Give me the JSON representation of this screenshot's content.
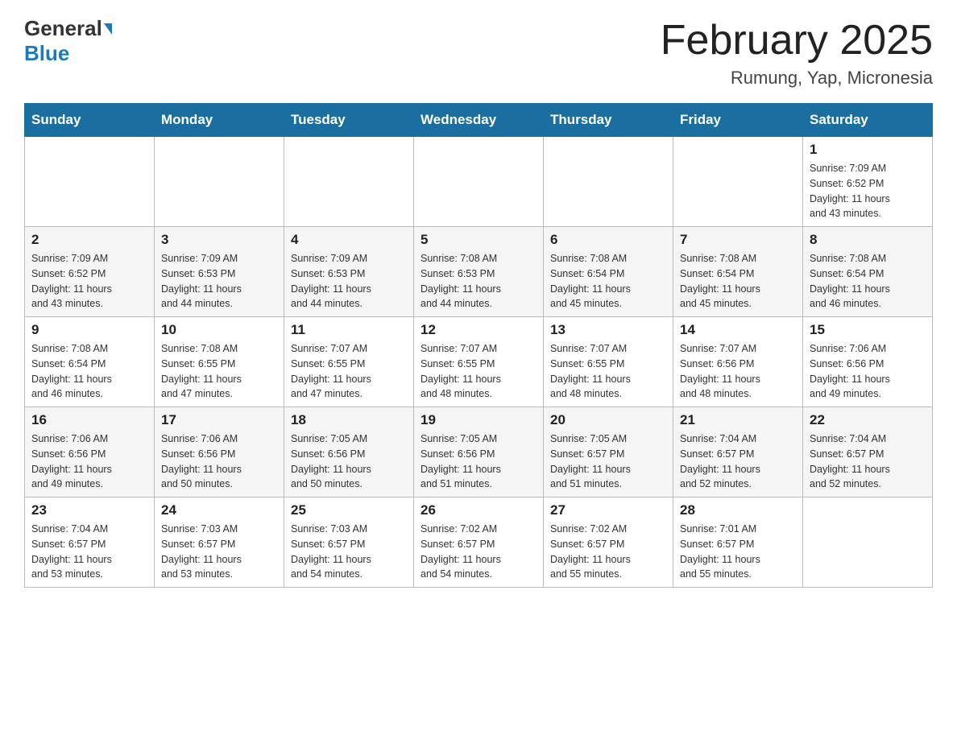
{
  "header": {
    "logo_general": "General",
    "logo_blue": "Blue",
    "month_title": "February 2025",
    "location": "Rumung, Yap, Micronesia"
  },
  "weekdays": [
    "Sunday",
    "Monday",
    "Tuesday",
    "Wednesday",
    "Thursday",
    "Friday",
    "Saturday"
  ],
  "weeks": [
    [
      {
        "day": "",
        "info": ""
      },
      {
        "day": "",
        "info": ""
      },
      {
        "day": "",
        "info": ""
      },
      {
        "day": "",
        "info": ""
      },
      {
        "day": "",
        "info": ""
      },
      {
        "day": "",
        "info": ""
      },
      {
        "day": "1",
        "info": "Sunrise: 7:09 AM\nSunset: 6:52 PM\nDaylight: 11 hours\nand 43 minutes."
      }
    ],
    [
      {
        "day": "2",
        "info": "Sunrise: 7:09 AM\nSunset: 6:52 PM\nDaylight: 11 hours\nand 43 minutes."
      },
      {
        "day": "3",
        "info": "Sunrise: 7:09 AM\nSunset: 6:53 PM\nDaylight: 11 hours\nand 44 minutes."
      },
      {
        "day": "4",
        "info": "Sunrise: 7:09 AM\nSunset: 6:53 PM\nDaylight: 11 hours\nand 44 minutes."
      },
      {
        "day": "5",
        "info": "Sunrise: 7:08 AM\nSunset: 6:53 PM\nDaylight: 11 hours\nand 44 minutes."
      },
      {
        "day": "6",
        "info": "Sunrise: 7:08 AM\nSunset: 6:54 PM\nDaylight: 11 hours\nand 45 minutes."
      },
      {
        "day": "7",
        "info": "Sunrise: 7:08 AM\nSunset: 6:54 PM\nDaylight: 11 hours\nand 45 minutes."
      },
      {
        "day": "8",
        "info": "Sunrise: 7:08 AM\nSunset: 6:54 PM\nDaylight: 11 hours\nand 46 minutes."
      }
    ],
    [
      {
        "day": "9",
        "info": "Sunrise: 7:08 AM\nSunset: 6:54 PM\nDaylight: 11 hours\nand 46 minutes."
      },
      {
        "day": "10",
        "info": "Sunrise: 7:08 AM\nSunset: 6:55 PM\nDaylight: 11 hours\nand 47 minutes."
      },
      {
        "day": "11",
        "info": "Sunrise: 7:07 AM\nSunset: 6:55 PM\nDaylight: 11 hours\nand 47 minutes."
      },
      {
        "day": "12",
        "info": "Sunrise: 7:07 AM\nSunset: 6:55 PM\nDaylight: 11 hours\nand 48 minutes."
      },
      {
        "day": "13",
        "info": "Sunrise: 7:07 AM\nSunset: 6:55 PM\nDaylight: 11 hours\nand 48 minutes."
      },
      {
        "day": "14",
        "info": "Sunrise: 7:07 AM\nSunset: 6:56 PM\nDaylight: 11 hours\nand 48 minutes."
      },
      {
        "day": "15",
        "info": "Sunrise: 7:06 AM\nSunset: 6:56 PM\nDaylight: 11 hours\nand 49 minutes."
      }
    ],
    [
      {
        "day": "16",
        "info": "Sunrise: 7:06 AM\nSunset: 6:56 PM\nDaylight: 11 hours\nand 49 minutes."
      },
      {
        "day": "17",
        "info": "Sunrise: 7:06 AM\nSunset: 6:56 PM\nDaylight: 11 hours\nand 50 minutes."
      },
      {
        "day": "18",
        "info": "Sunrise: 7:05 AM\nSunset: 6:56 PM\nDaylight: 11 hours\nand 50 minutes."
      },
      {
        "day": "19",
        "info": "Sunrise: 7:05 AM\nSunset: 6:56 PM\nDaylight: 11 hours\nand 51 minutes."
      },
      {
        "day": "20",
        "info": "Sunrise: 7:05 AM\nSunset: 6:57 PM\nDaylight: 11 hours\nand 51 minutes."
      },
      {
        "day": "21",
        "info": "Sunrise: 7:04 AM\nSunset: 6:57 PM\nDaylight: 11 hours\nand 52 minutes."
      },
      {
        "day": "22",
        "info": "Sunrise: 7:04 AM\nSunset: 6:57 PM\nDaylight: 11 hours\nand 52 minutes."
      }
    ],
    [
      {
        "day": "23",
        "info": "Sunrise: 7:04 AM\nSunset: 6:57 PM\nDaylight: 11 hours\nand 53 minutes."
      },
      {
        "day": "24",
        "info": "Sunrise: 7:03 AM\nSunset: 6:57 PM\nDaylight: 11 hours\nand 53 minutes."
      },
      {
        "day": "25",
        "info": "Sunrise: 7:03 AM\nSunset: 6:57 PM\nDaylight: 11 hours\nand 54 minutes."
      },
      {
        "day": "26",
        "info": "Sunrise: 7:02 AM\nSunset: 6:57 PM\nDaylight: 11 hours\nand 54 minutes."
      },
      {
        "day": "27",
        "info": "Sunrise: 7:02 AM\nSunset: 6:57 PM\nDaylight: 11 hours\nand 55 minutes."
      },
      {
        "day": "28",
        "info": "Sunrise: 7:01 AM\nSunset: 6:57 PM\nDaylight: 11 hours\nand 55 minutes."
      },
      {
        "day": "",
        "info": ""
      }
    ]
  ]
}
